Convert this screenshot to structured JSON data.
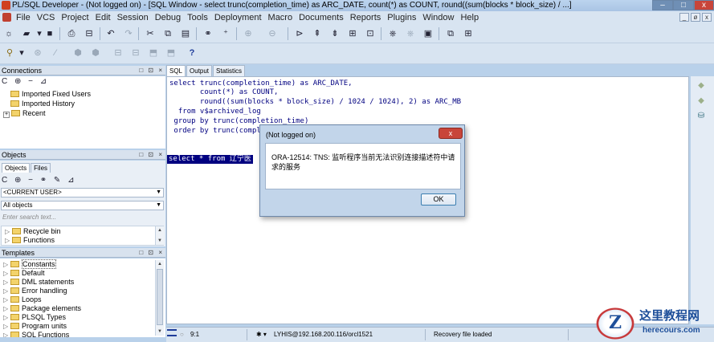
{
  "window": {
    "title": "PL/SQL Developer - (Not logged on) - [SQL Window - select trunc(completion_time) as ARC_DATE, count(*) as COUNT, round((sum(blocks * block_size) / ...]",
    "min_glyph": "–",
    "max_glyph": "□",
    "close_glyph": "x"
  },
  "menubar": {
    "items": [
      "File",
      "VCS",
      "Project",
      "Edit",
      "Session",
      "Debug",
      "Tools",
      "Deployment",
      "Macro",
      "Documents",
      "Reports",
      "Plugins",
      "Window",
      "Help"
    ],
    "mdi_min": "_",
    "mdi_restore": "ø",
    "mdi_close": "x"
  },
  "connections": {
    "title": "Connections",
    "header_buttons": "□ ⊡ ×",
    "toolbar": "C ⊕ − ⊿",
    "items": [
      {
        "label": "Imported Fixed Users",
        "expander": ""
      },
      {
        "label": "Imported History",
        "expander": ""
      },
      {
        "label": "Recent",
        "expander": "+"
      }
    ]
  },
  "objects": {
    "title": "Objects",
    "header_buttons": "□ ⊡ ×",
    "tabs": [
      "Objects",
      "Files"
    ],
    "toolbar": "C ⊕ − ⚭ ✎ ⊿",
    "user_combo": "<CURRENT USER>",
    "filter_combo": "All objects",
    "search_placeholder": "Enter search text...",
    "items": [
      {
        "label": "Recycle bin",
        "expander": "▷"
      },
      {
        "label": "Functions",
        "expander": "▷"
      }
    ]
  },
  "templates": {
    "title": "Templates",
    "header_buttons": "□ ⊡ ×",
    "items": [
      "Constants",
      "Default",
      "DML statements",
      "Error handling",
      "Loops",
      "Package elements",
      "PLSQL Types",
      "Program units",
      "SQL Functions"
    ]
  },
  "editor": {
    "tabs": [
      "SQL",
      "Output",
      "Statistics"
    ],
    "lines": [
      "select trunc(completion_time) as ARC_DATE,",
      "       count(*) as COUNT,",
      "       round((sum(blocks * block_size) / 1024 / 1024), 2) as ARC_MB",
      "  from v$archived_log",
      " group by trunc(completion_time)",
      " order by trunc(compl"
    ],
    "selected_line": "select * from 辽宁医"
  },
  "statusbar": {
    "position": "9:1",
    "connection": "LYHIS@192.168.200.116/orcl1521",
    "message": "Recovery file loaded",
    "conn_glyphs": "✱ ▾"
  },
  "dialog": {
    "title": "(Not logged on)",
    "message": "ORA-12514: TNS: 监听程序当前无法识别连接描述符中请求的服务",
    "ok_label": "OK",
    "close_glyph": "x"
  },
  "watermark": {
    "logo_letter": "Z",
    "title": "这里教程网",
    "url": "herecours.com"
  },
  "toolbar_icons": {
    "tb1": [
      "new-icon",
      "open-icon",
      "save-icon",
      "print-icon",
      "print-preview-icon",
      "undo-icon",
      "redo-icon",
      "cut-icon",
      "copy-icon",
      "paste-icon",
      "find-icon",
      "replace-icon",
      "indent-icon",
      "unindent-icon",
      "execute-icon",
      "step-icon",
      "debug-icon",
      "commit-icon",
      "rollback-icon",
      "explain-icon",
      "window-list-icon",
      "layout-icon"
    ],
    "tb2": [
      "tools-icon",
      "compile-icon",
      "wand-icon",
      "connect-icon",
      "disconnect-icon",
      "session-icon",
      "browser-icon",
      "report-icon",
      "help-icon"
    ]
  },
  "colors": {
    "window_bg": "#b9d1ea",
    "selection": "#000080",
    "code_keyword": "#000080",
    "dialog_close": "#c8453a",
    "watermark_blue": "#1e4f9a"
  }
}
